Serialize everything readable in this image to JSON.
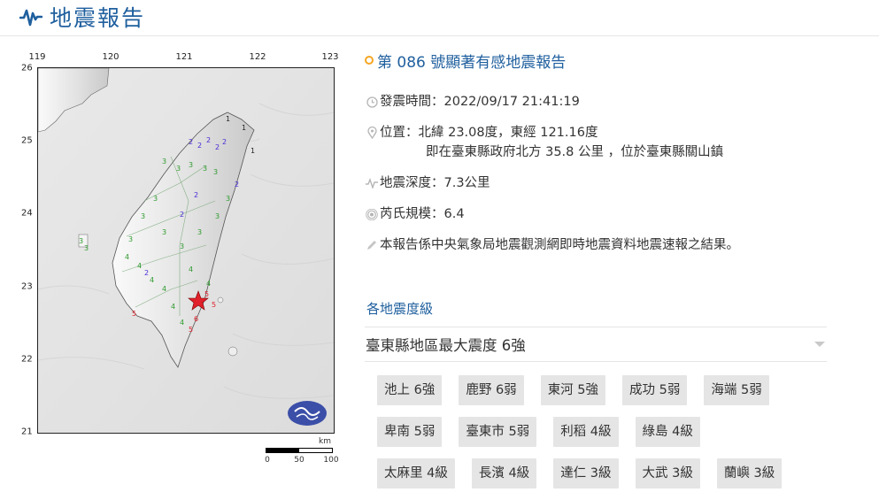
{
  "header": {
    "title": "地震報告"
  },
  "map": {
    "lon_ticks": [
      "119",
      "120",
      "121",
      "122",
      "123"
    ],
    "lat_ticks": [
      "26",
      "25",
      "24",
      "23",
      "22",
      "21"
    ],
    "scale_unit": "km",
    "scale_ticks": [
      "0",
      "50",
      "100"
    ],
    "intensity_colors": {
      "1": "#222222",
      "2": "#4a2ad6",
      "3": "#2e9a2e",
      "4": "#2e9a2e",
      "5": "#e0202a",
      "6": "#e0202a"
    },
    "icons": {
      "epicenter": "star-icon",
      "logo": "cwb-logo-icon"
    }
  },
  "report": {
    "title": "第 086 號顯著有感地震報告",
    "time": "發震時間：2022/09/17 21:41:19",
    "location": "位置：北緯 23.08度，東經 121.16度",
    "location_sub": "即在臺東縣政府北方 35.8 公里 ，位於臺東縣關山鎮",
    "depth": "地震深度：7.3公里",
    "magnitude": "芮氏規模：6.4",
    "note": "本報告係中央氣象局地震觀測網即時地震資料地震速報之結果。",
    "icons": [
      "clock-icon",
      "pin-icon",
      "wave-icon",
      "magnitude-icon",
      "pencil-icon"
    ]
  },
  "intensity": {
    "section_title": "各地震度級",
    "max_text": "臺東縣地區最大震度 6強",
    "rows": [
      [
        "池上 6強",
        "鹿野 6弱",
        "東河 5強",
        "成功 5弱",
        "海端 5弱"
      ],
      [
        "卑南 5弱",
        "臺東市 5弱",
        "利稻 4級",
        "綠島 4級"
      ],
      [
        "太麻里 4級",
        "長濱 4級",
        "達仁 3級",
        "大武 3級",
        "蘭嶼 3級"
      ]
    ]
  }
}
